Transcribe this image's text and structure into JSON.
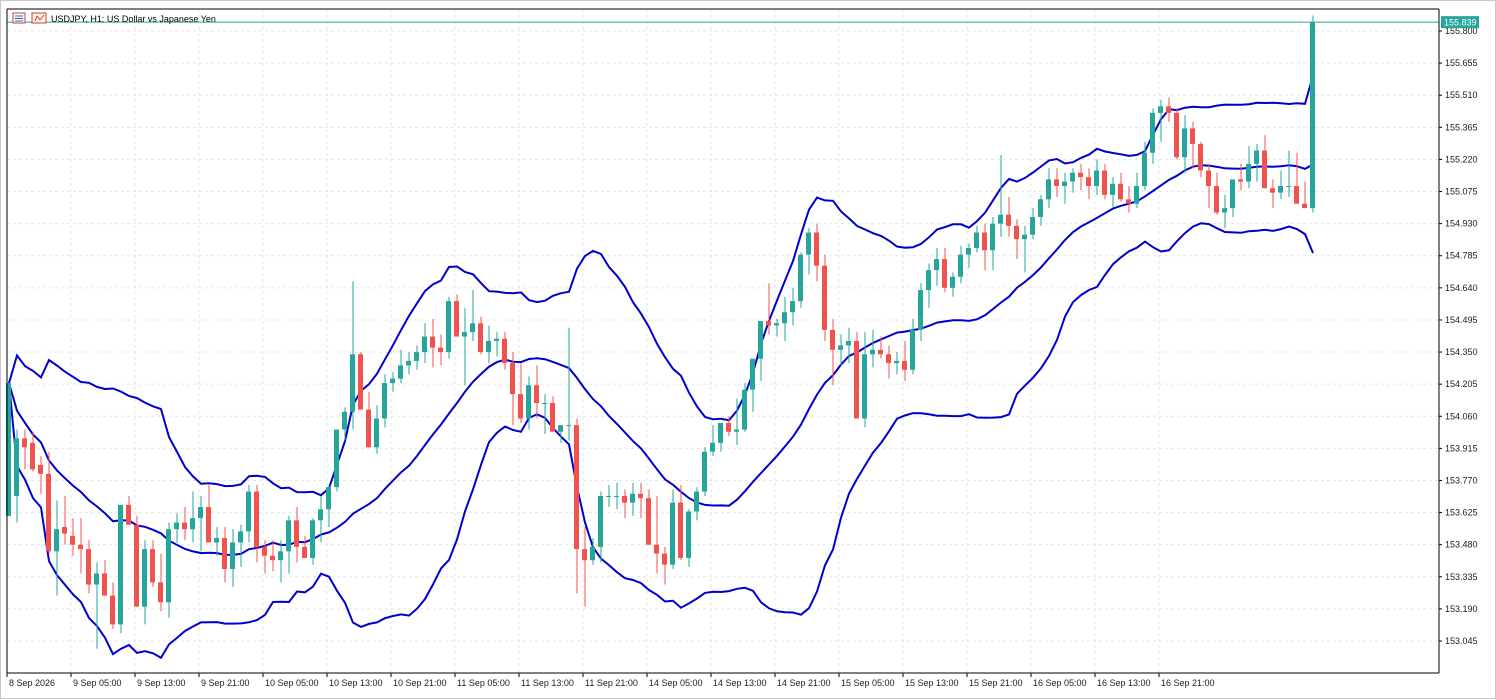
{
  "header": {
    "title": "USDJPY, H1:  US Dollar vs Japanese Yen",
    "icons": [
      "chart-list-icon",
      "chart-properties-icon"
    ]
  },
  "price_tag": {
    "label": "155.839",
    "color": "#26a69a"
  },
  "colors": {
    "bull": "#26a69a",
    "bear": "#ef5350",
    "bands": "#0000cc",
    "grid": "#e6e6e6"
  },
  "chart_data": {
    "type": "candlestick",
    "ylim": [
      152.96,
      155.89
    ],
    "yticks": [
      "155.800",
      "155.655",
      "155.510",
      "155.365",
      "155.220",
      "155.075",
      "154.930",
      "154.785",
      "154.640",
      "154.495",
      "154.350",
      "154.205",
      "154.060",
      "153.915",
      "153.770",
      "153.625",
      "153.480",
      "153.335",
      "153.190",
      "153.045"
    ],
    "xticks": [
      "8 Sep 2026",
      "9 Sep 05:00",
      "9 Sep 13:00",
      "9 Sep 21:00",
      "10 Sep 05:00",
      "10 Sep 13:00",
      "10 Sep 21:00",
      "11 Sep 05:00",
      "11 Sep 13:00",
      "11 Sep 21:00",
      "14 Sep 05:00",
      "14 Sep 13:00",
      "14 Sep 21:00",
      "15 Sep 05:00",
      "15 Sep 13:00",
      "15 Sep 21:00",
      "16 Sep 05:00",
      "16 Sep 13:00",
      "16 Sep 21:00"
    ],
    "indicator": "Bollinger Bands",
    "candles": [
      [
        153.61,
        154.21,
        153.61,
        154.21
      ],
      [
        153.7,
        154.0,
        153.58,
        153.96
      ],
      [
        153.96,
        154.0,
        153.82,
        153.92
      ],
      [
        153.94,
        153.99,
        153.81,
        153.82
      ],
      [
        153.84,
        153.88,
        153.71,
        153.8
      ],
      [
        153.8,
        153.9,
        153.44,
        153.45
      ],
      [
        153.45,
        153.68,
        153.25,
        153.55
      ],
      [
        153.56,
        153.7,
        153.48,
        153.53
      ],
      [
        153.52,
        153.6,
        153.43,
        153.48
      ],
      [
        153.48,
        153.6,
        153.35,
        153.46
      ],
      [
        153.46,
        153.5,
        153.26,
        153.3
      ],
      [
        153.3,
        153.4,
        153.01,
        153.35
      ],
      [
        153.35,
        153.41,
        153.27,
        153.25
      ],
      [
        153.25,
        153.31,
        153.1,
        153.12
      ],
      [
        153.12,
        153.66,
        153.08,
        153.66
      ],
      [
        153.66,
        153.7,
        153.59,
        153.57
      ],
      [
        153.57,
        153.61,
        153.2,
        153.2
      ],
      [
        153.2,
        153.5,
        153.12,
        153.46
      ],
      [
        153.46,
        153.5,
        153.29,
        153.31
      ],
      [
        153.31,
        153.44,
        153.18,
        153.22
      ],
      [
        153.22,
        153.58,
        153.15,
        153.55
      ],
      [
        153.55,
        153.62,
        153.49,
        153.58
      ],
      [
        153.58,
        153.65,
        153.5,
        153.55
      ],
      [
        153.55,
        153.72,
        153.49,
        153.6
      ],
      [
        153.6,
        153.7,
        153.45,
        153.65
      ],
      [
        153.65,
        153.75,
        153.57,
        153.49
      ],
      [
        153.49,
        153.56,
        153.43,
        153.51
      ],
      [
        153.51,
        153.56,
        153.31,
        153.37
      ],
      [
        153.37,
        153.55,
        153.29,
        153.49
      ],
      [
        153.49,
        153.57,
        153.38,
        153.54
      ],
      [
        153.54,
        153.75,
        153.49,
        153.72
      ],
      [
        153.72,
        153.75,
        153.4,
        153.47
      ],
      [
        153.47,
        153.5,
        153.35,
        153.43
      ],
      [
        153.43,
        153.5,
        153.36,
        153.41
      ],
      [
        153.41,
        153.5,
        153.31,
        153.45
      ],
      [
        153.45,
        153.61,
        153.35,
        153.59
      ],
      [
        153.59,
        153.65,
        153.4,
        153.47
      ],
      [
        153.47,
        153.52,
        153.43,
        153.42
      ],
      [
        153.42,
        153.6,
        153.39,
        153.59
      ],
      [
        153.59,
        153.7,
        153.49,
        153.64
      ],
      [
        153.64,
        153.75,
        153.56,
        153.74
      ],
      [
        153.74,
        154.0,
        153.72,
        154.0
      ],
      [
        154.0,
        154.1,
        153.95,
        154.08
      ],
      [
        154.08,
        154.67,
        154.0,
        154.34
      ],
      [
        154.34,
        154.35,
        154.09,
        154.09
      ],
      [
        154.09,
        154.17,
        153.92,
        153.92
      ],
      [
        153.92,
        154.11,
        153.89,
        154.05
      ],
      [
        154.05,
        154.25,
        154.01,
        154.21
      ],
      [
        154.21,
        154.26,
        154.17,
        154.23
      ],
      [
        154.23,
        154.36,
        154.21,
        154.29
      ],
      [
        154.29,
        154.35,
        154.25,
        154.31
      ],
      [
        154.31,
        154.38,
        154.27,
        154.35
      ],
      [
        154.35,
        154.48,
        154.3,
        154.42
      ],
      [
        154.42,
        154.5,
        154.28,
        154.37
      ],
      [
        154.37,
        154.43,
        154.29,
        154.35
      ],
      [
        154.35,
        154.6,
        154.32,
        154.58
      ],
      [
        154.58,
        154.61,
        154.51,
        154.42
      ],
      [
        154.42,
        154.55,
        154.2,
        154.44
      ],
      [
        154.44,
        154.63,
        154.4,
        154.48
      ],
      [
        154.48,
        154.51,
        154.34,
        154.35
      ],
      [
        154.35,
        154.47,
        154.3,
        154.4
      ],
      [
        154.4,
        154.44,
        154.33,
        154.41
      ],
      [
        154.41,
        154.44,
        154.27,
        154.3
      ],
      [
        154.3,
        154.35,
        154.02,
        154.16
      ],
      [
        154.16,
        154.3,
        154.03,
        154.05
      ],
      [
        154.05,
        154.24,
        154.0,
        154.2
      ],
      [
        154.2,
        154.29,
        154.05,
        154.12
      ],
      [
        154.12,
        154.16,
        153.98,
        154.12
      ],
      [
        154.12,
        154.15,
        154.0,
        153.99
      ],
      [
        153.99,
        154.0,
        153.94,
        154.02
      ],
      [
        154.02,
        154.46,
        153.95,
        154.02
      ],
      [
        154.02,
        154.05,
        153.26,
        153.46
      ],
      [
        153.46,
        153.56,
        153.2,
        153.41
      ],
      [
        153.41,
        153.51,
        153.39,
        153.47
      ],
      [
        153.47,
        153.72,
        153.4,
        153.7
      ],
      [
        153.7,
        153.75,
        153.65,
        153.7
      ],
      [
        153.7,
        153.76,
        153.64,
        153.7
      ],
      [
        153.7,
        153.73,
        153.6,
        153.67
      ],
      [
        153.67,
        153.76,
        153.61,
        153.71
      ],
      [
        153.71,
        153.76,
        153.6,
        153.69
      ],
      [
        153.69,
        153.73,
        153.48,
        153.48
      ],
      [
        153.48,
        153.7,
        153.35,
        153.44
      ],
      [
        153.44,
        153.47,
        153.3,
        153.39
      ],
      [
        153.39,
        153.73,
        153.37,
        153.67
      ],
      [
        153.67,
        153.75,
        153.41,
        153.42
      ],
      [
        153.42,
        153.64,
        153.38,
        153.63
      ],
      [
        153.63,
        153.74,
        153.59,
        153.72
      ],
      [
        153.72,
        153.92,
        153.7,
        153.9
      ],
      [
        153.9,
        154.02,
        153.88,
        153.94
      ],
      [
        153.94,
        154.03,
        153.9,
        154.03
      ],
      [
        154.03,
        154.06,
        153.97,
        153.99
      ],
      [
        153.99,
        154.14,
        153.93,
        154.0
      ],
      [
        154.0,
        154.21,
        153.99,
        154.18
      ],
      [
        154.18,
        154.29,
        154.08,
        154.32
      ],
      [
        154.32,
        154.48,
        154.22,
        154.49
      ],
      [
        154.49,
        154.66,
        154.43,
        154.47
      ],
      [
        154.47,
        154.5,
        154.42,
        154.48
      ],
      [
        154.48,
        154.6,
        154.4,
        154.53
      ],
      [
        154.53,
        154.64,
        154.47,
        154.58
      ],
      [
        154.58,
        154.8,
        154.55,
        154.79
      ],
      [
        154.79,
        154.91,
        154.7,
        154.89
      ],
      [
        154.89,
        154.93,
        154.67,
        154.74
      ],
      [
        154.74,
        154.79,
        154.4,
        154.45
      ],
      [
        154.45,
        154.5,
        154.2,
        154.36
      ],
      [
        154.36,
        154.43,
        154.29,
        154.38
      ],
      [
        154.38,
        154.46,
        154.3,
        154.4
      ],
      [
        154.4,
        154.44,
        154.05,
        154.05
      ],
      [
        154.05,
        154.44,
        154.01,
        154.34
      ],
      [
        154.34,
        154.45,
        154.28,
        154.36
      ],
      [
        154.36,
        154.42,
        154.32,
        154.34
      ],
      [
        154.34,
        154.38,
        154.23,
        154.3
      ],
      [
        154.3,
        154.35,
        154.25,
        154.31
      ],
      [
        154.31,
        154.4,
        154.22,
        154.27
      ],
      [
        154.27,
        154.5,
        154.25,
        154.45
      ],
      [
        154.45,
        154.66,
        154.4,
        154.63
      ],
      [
        154.63,
        154.75,
        154.55,
        154.72
      ],
      [
        154.72,
        154.82,
        154.65,
        154.77
      ],
      [
        154.77,
        154.82,
        154.62,
        154.64
      ],
      [
        154.64,
        154.71,
        154.6,
        154.69
      ],
      [
        154.69,
        154.83,
        154.66,
        154.79
      ],
      [
        154.79,
        154.84,
        154.73,
        154.82
      ],
      [
        154.82,
        154.92,
        154.8,
        154.89
      ],
      [
        154.89,
        154.93,
        154.72,
        154.81
      ],
      [
        154.81,
        154.96,
        154.72,
        154.93
      ],
      [
        154.93,
        155.24,
        154.87,
        154.97
      ],
      [
        154.97,
        155.05,
        154.87,
        154.92
      ],
      [
        154.92,
        154.95,
        154.77,
        154.86
      ],
      [
        154.86,
        154.92,
        154.71,
        154.88
      ],
      [
        154.88,
        155.0,
        154.86,
        154.96
      ],
      [
        154.96,
        155.06,
        154.92,
        155.04
      ],
      [
        155.04,
        155.18,
        155.0,
        155.13
      ],
      [
        155.13,
        155.18,
        155.05,
        155.1
      ],
      [
        155.1,
        155.16,
        155.02,
        155.12
      ],
      [
        155.12,
        155.18,
        155.07,
        155.16
      ],
      [
        155.16,
        155.2,
        155.08,
        155.14
      ],
      [
        155.14,
        155.18,
        155.04,
        155.1
      ],
      [
        155.1,
        155.22,
        155.06,
        155.17
      ],
      [
        155.17,
        155.2,
        155.04,
        155.06
      ],
      [
        155.06,
        155.14,
        155.0,
        155.11
      ],
      [
        155.11,
        155.16,
        155.03,
        155.04
      ],
      [
        155.04,
        155.1,
        154.98,
        155.02
      ],
      [
        155.02,
        155.16,
        155.0,
        155.1
      ],
      [
        155.1,
        155.3,
        155.08,
        155.25
      ],
      [
        155.25,
        155.45,
        155.2,
        155.43
      ],
      [
        155.43,
        155.49,
        155.3,
        155.46
      ],
      [
        155.46,
        155.5,
        155.39,
        155.43
      ],
      [
        155.43,
        155.45,
        155.22,
        155.23
      ],
      [
        155.23,
        155.42,
        155.16,
        155.36
      ],
      [
        155.36,
        155.39,
        155.18,
        155.29
      ],
      [
        155.29,
        155.3,
        155.14,
        155.17
      ],
      [
        155.17,
        155.2,
        155.0,
        155.1
      ],
      [
        155.1,
        155.16,
        154.97,
        154.98
      ],
      [
        154.98,
        155.06,
        154.91,
        155.0
      ],
      [
        155.0,
        155.11,
        154.96,
        155.13
      ],
      [
        155.13,
        155.2,
        155.08,
        155.12
      ],
      [
        155.12,
        155.28,
        155.09,
        155.2
      ],
      [
        155.2,
        155.29,
        155.12,
        155.26
      ],
      [
        155.26,
        155.33,
        155.12,
        155.09
      ],
      [
        155.09,
        155.13,
        155.0,
        155.07
      ],
      [
        155.07,
        155.17,
        155.04,
        155.1
      ],
      [
        155.1,
        155.26,
        155.05,
        155.1
      ],
      [
        155.1,
        155.25,
        155.04,
        155.02
      ],
      [
        155.02,
        155.12,
        155.0,
        155.0
      ],
      [
        155.0,
        155.87,
        154.98,
        155.84
      ]
    ]
  }
}
